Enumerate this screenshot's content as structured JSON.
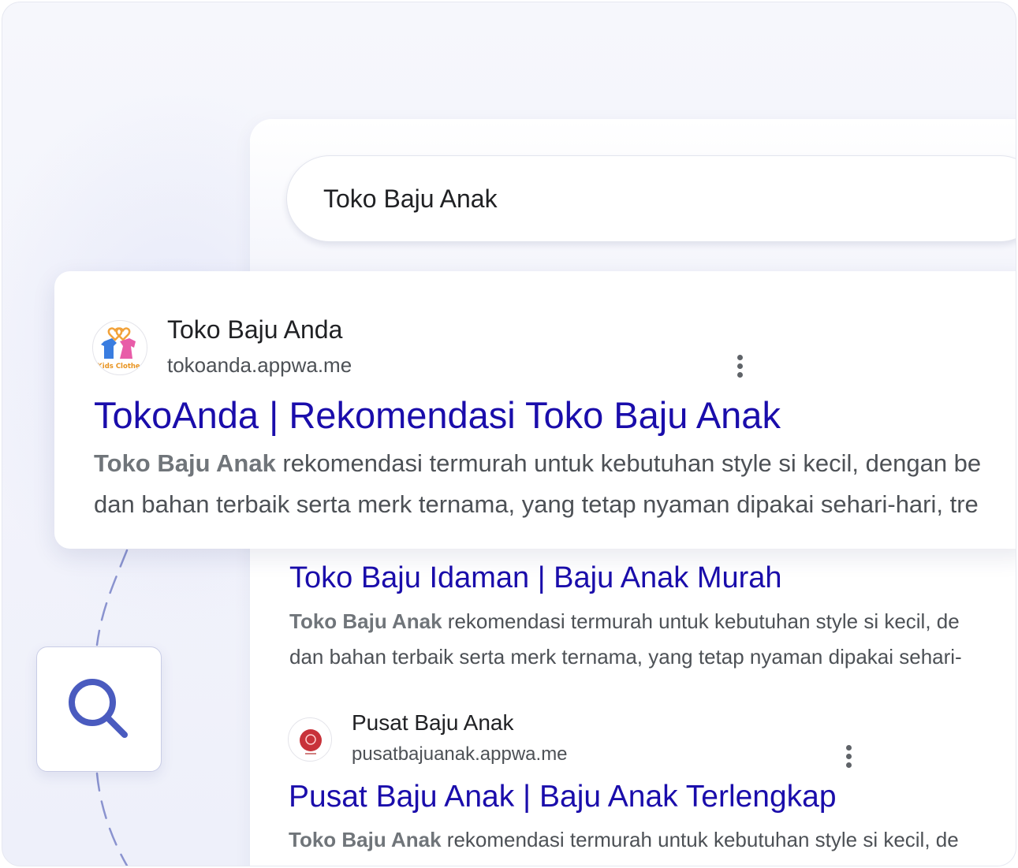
{
  "search": {
    "query": "Toko Baju Anak"
  },
  "results": [
    {
      "site_name": "Toko Baju Anda",
      "url": "tokoanda.appwa.me",
      "favicon": "kids-clothes-logo",
      "favicon_text": "Kids Clothes",
      "title": "TokoAnda | Rekomendasi Toko Baju Anak",
      "snippet_bold": "Toko Baju Anak",
      "snippet_rest_line1": " rekomendasi termurah untuk kebutuhan style si kecil, dengan be",
      "snippet_line2": "dan bahan terbaik serta merk ternama, yang tetap nyaman dipakai sehari-hari, tre"
    },
    {
      "title": "Toko Baju Idaman | Baju Anak Murah",
      "snippet_bold": "Toko Baju Anak",
      "snippet_rest_line1": " rekomendasi termurah untuk kebutuhan style si kecil, de",
      "snippet_line2": "dan bahan terbaik serta merk ternama, yang tetap nyaman dipakai sehari-"
    },
    {
      "site_name": "Pusat Baju Anak",
      "url": "pusatbajuanak.appwa.me",
      "favicon": "red-circle-logo",
      "title": "Pusat Baju Anak | Baju Anak Terlengkap",
      "snippet_bold": "Toko Baju Anak",
      "snippet_rest_line1": " rekomendasi termurah untuk kebutuhan style si kecil, de"
    }
  ],
  "colors": {
    "link": "#1a0dab",
    "text": "#4d5156",
    "accent": "#4a5bbf",
    "dash": "#7d88c9"
  },
  "icons": {
    "search_tile": "magnifier-icon",
    "more": "more-vert-icon"
  }
}
